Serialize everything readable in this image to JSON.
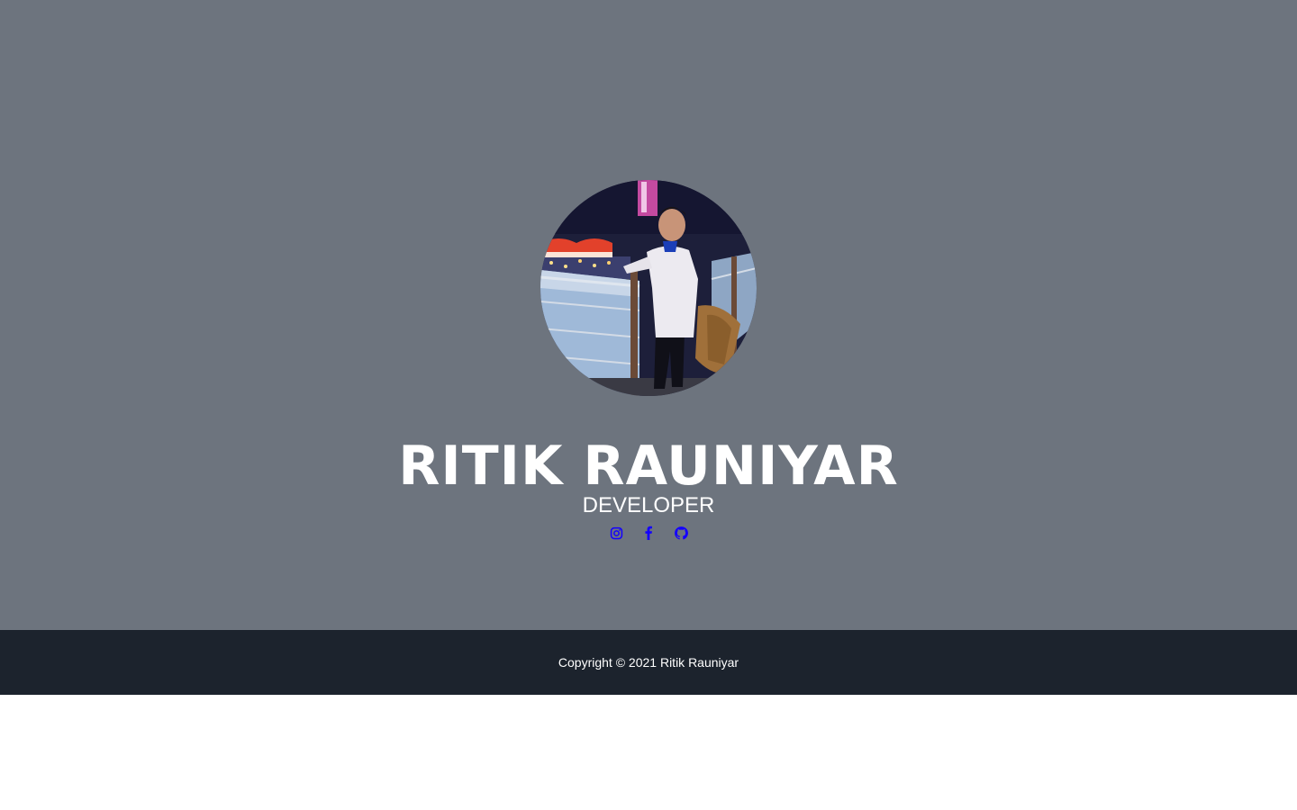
{
  "hero": {
    "name": "RITIK RAUNIYAR",
    "role": "DEVELOPER",
    "background_color": "#6d747e",
    "text_color": "#ffffff"
  },
  "avatar": {
    "alt": "Ritik Rauniyar"
  },
  "socials": [
    {
      "icon": "instagram-icon",
      "label": "Instagram"
    },
    {
      "icon": "facebook-icon",
      "label": "Facebook"
    },
    {
      "icon": "github-icon",
      "label": "GitHub"
    }
  ],
  "social_icon_color": "#1400ff",
  "footer": {
    "copyright": "Copyright © 2021 Ritik Rauniyar",
    "background_color": "#1c232d"
  }
}
